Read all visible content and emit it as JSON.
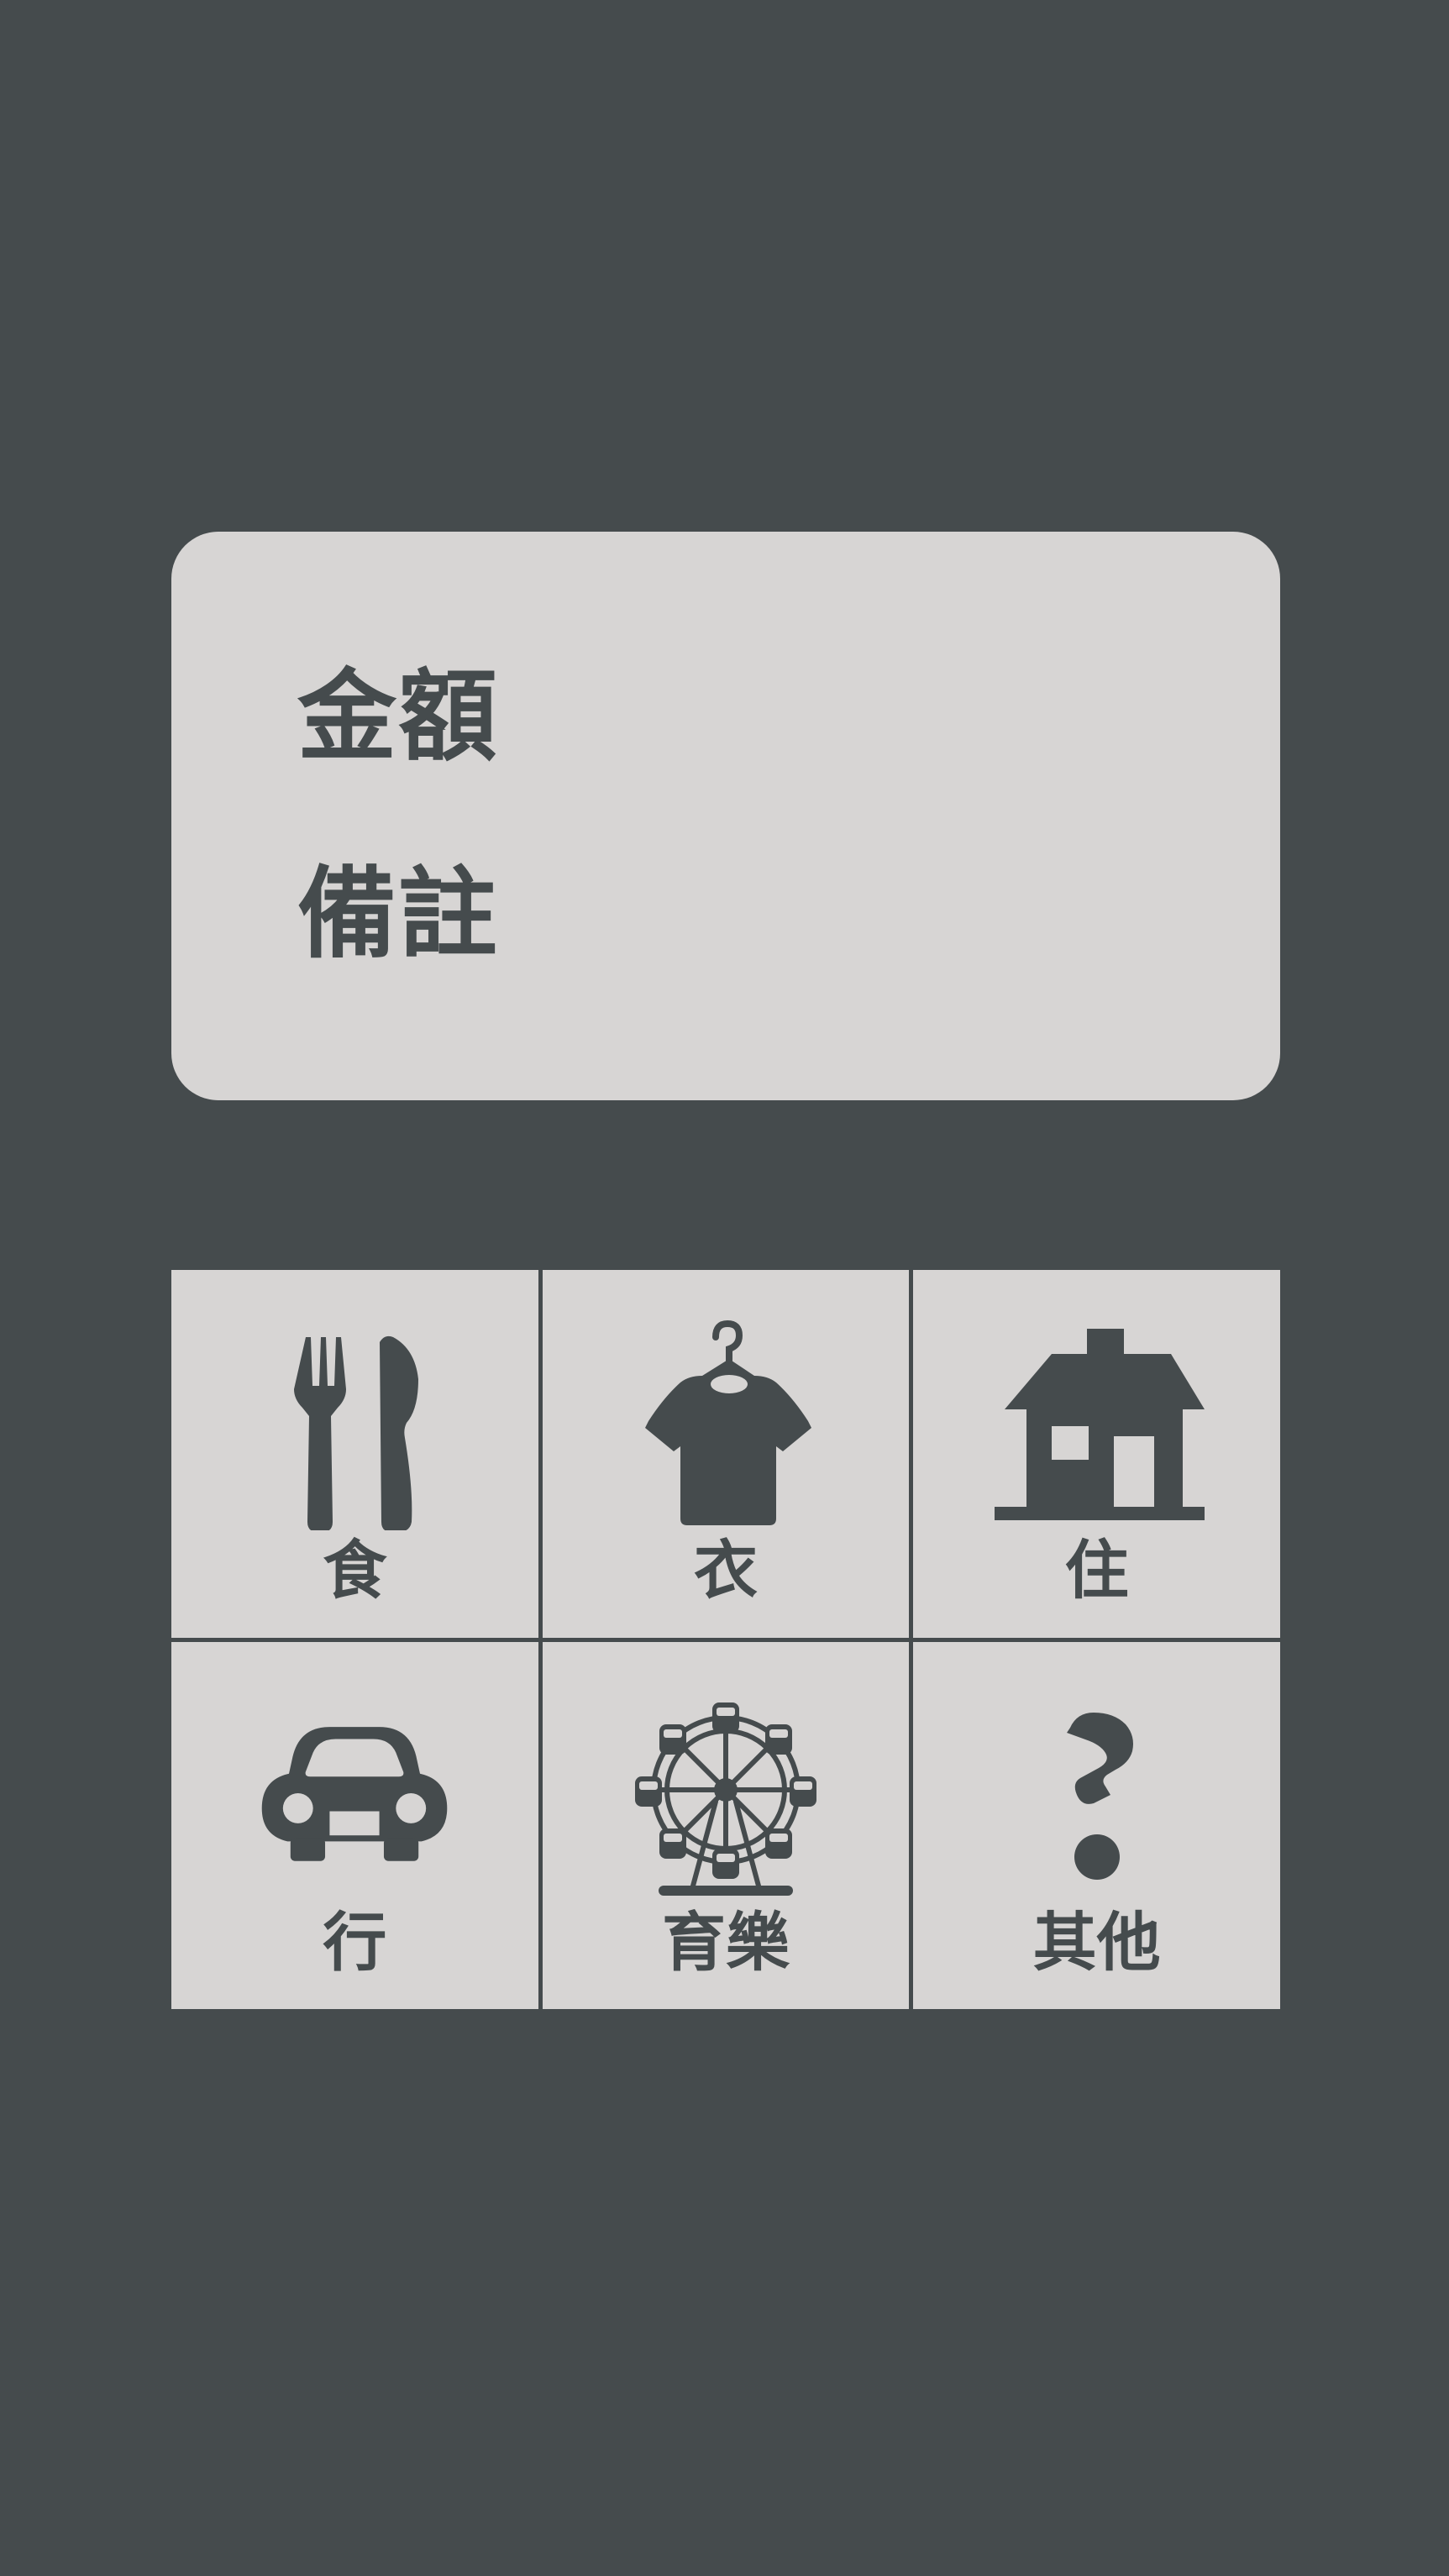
{
  "colors": {
    "background": "#454b4d",
    "card": "#d7d5d4",
    "ink": "#454b4d"
  },
  "form": {
    "amount_label": "金額",
    "note_label": "備註"
  },
  "categories": [
    {
      "label": "食",
      "icon": "fork-knife-icon"
    },
    {
      "label": "衣",
      "icon": "shirt-hanger-icon"
    },
    {
      "label": "住",
      "icon": "house-icon"
    },
    {
      "label": "行",
      "icon": "car-icon"
    },
    {
      "label": "育樂",
      "icon": "ferris-wheel-icon"
    },
    {
      "label": "其他",
      "icon": "question-mark-icon"
    }
  ]
}
